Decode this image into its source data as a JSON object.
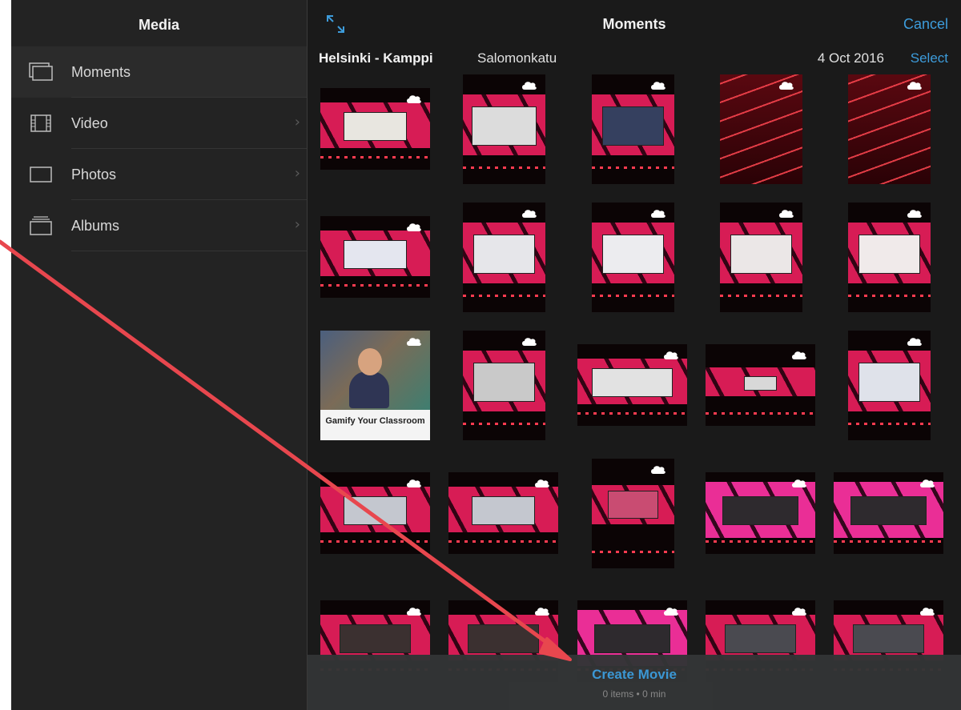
{
  "sidebar": {
    "title": "Media",
    "items": [
      {
        "label": "Moments",
        "icon": "moments-icon",
        "chevron": false
      },
      {
        "label": "Video",
        "icon": "film-icon",
        "chevron": true
      },
      {
        "label": "Photos",
        "icon": "photo-icon",
        "chevron": true
      },
      {
        "label": "Albums",
        "icon": "albums-icon",
        "chevron": true
      }
    ],
    "chevron_glyph": "›"
  },
  "topbar": {
    "title": "Moments",
    "cancel_label": "Cancel",
    "expand_icon": "expand-arrows-icon"
  },
  "location": {
    "title": "Helsinki - Kamppi",
    "subtitle": "Salomonkatu",
    "date": "4 Oct 2016",
    "select_label": "Select"
  },
  "grid": {
    "thumb_text": "Gamify Your Classroom",
    "cloud_icon": "icloud-icon"
  },
  "bottom_bar": {
    "create_label": "Create Movie",
    "meta": "0 items • 0 min"
  },
  "colors": {
    "accent": "#3d9cdb",
    "annotation_arrow": "#e8474e",
    "stage_pink": "#d71c55"
  }
}
